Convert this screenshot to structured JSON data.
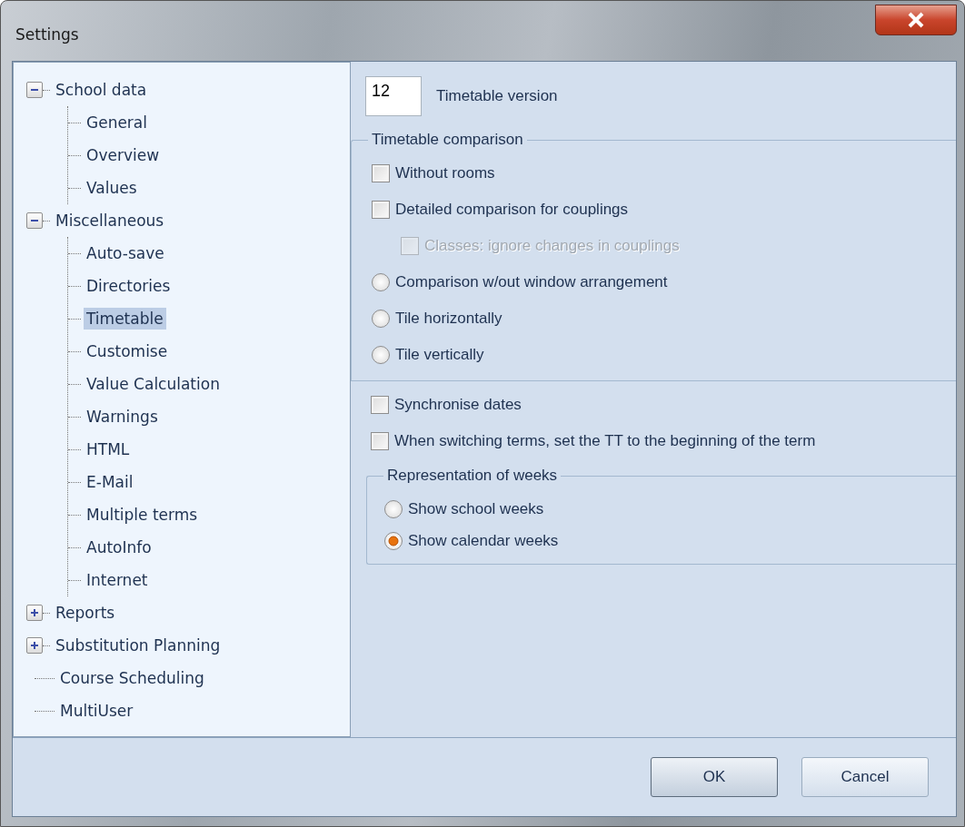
{
  "window": {
    "title": "Settings"
  },
  "tree": [
    {
      "label": "School data",
      "expanded": true,
      "selected": false,
      "children": [
        {
          "label": "General",
          "selected": false
        },
        {
          "label": "Overview",
          "selected": false
        },
        {
          "label": "Values",
          "selected": false
        }
      ]
    },
    {
      "label": "Miscellaneous",
      "expanded": true,
      "selected": false,
      "children": [
        {
          "label": "Auto-save",
          "selected": false
        },
        {
          "label": "Directories",
          "selected": false
        },
        {
          "label": "Timetable",
          "selected": true
        },
        {
          "label": "Customise",
          "selected": false
        },
        {
          "label": "Value Calculation",
          "selected": false
        },
        {
          "label": "Warnings",
          "selected": false
        },
        {
          "label": "HTML",
          "selected": false
        },
        {
          "label": "E-Mail",
          "selected": false
        },
        {
          "label": "Multiple terms",
          "selected": false
        },
        {
          "label": "AutoInfo",
          "selected": false
        },
        {
          "label": "Internet",
          "selected": false
        }
      ]
    },
    {
      "label": "Reports",
      "expanded": false,
      "selected": false
    },
    {
      "label": "Substitution Planning",
      "expanded": false,
      "selected": false
    },
    {
      "label": "Course Scheduling",
      "selected": false
    },
    {
      "label": "MultiUser",
      "selected": false
    }
  ],
  "version": {
    "value": "12",
    "label": "Timetable version"
  },
  "comparison": {
    "title": "Timetable comparison",
    "options": [
      {
        "kind": "checkbox",
        "label": "Without rooms",
        "checked": false,
        "disabled": false
      },
      {
        "kind": "checkbox",
        "label": "Detailed comparison for couplings",
        "checked": false,
        "disabled": false,
        "children": [
          {
            "kind": "checkbox",
            "label": "Classes: ignore changes in couplings",
            "checked": false,
            "disabled": true
          }
        ]
      },
      {
        "kind": "radio",
        "label": "Comparison w/out window arrangement",
        "selected": false,
        "disabled": false
      },
      {
        "kind": "radio",
        "label": "Tile horizontally",
        "selected": false,
        "disabled": false
      },
      {
        "kind": "radio",
        "label": "Tile vertically",
        "selected": false,
        "disabled": false
      }
    ]
  },
  "options": [
    {
      "kind": "checkbox",
      "label": "Synchronise dates",
      "checked": false,
      "disabled": false
    },
    {
      "kind": "checkbox",
      "label": "When switching terms, set the TT to the beginning of the term",
      "checked": false,
      "disabled": false
    }
  ],
  "weeks": {
    "title": "Representation of weeks",
    "options": [
      {
        "kind": "radio",
        "label": "Show school weeks",
        "selected": false,
        "disabled": false
      },
      {
        "kind": "radio",
        "label": "Show calendar weeks",
        "selected": true,
        "disabled": false
      }
    ]
  },
  "buttons": [
    {
      "label": "OK",
      "default": true
    },
    {
      "label": "Cancel",
      "default": false
    }
  ]
}
